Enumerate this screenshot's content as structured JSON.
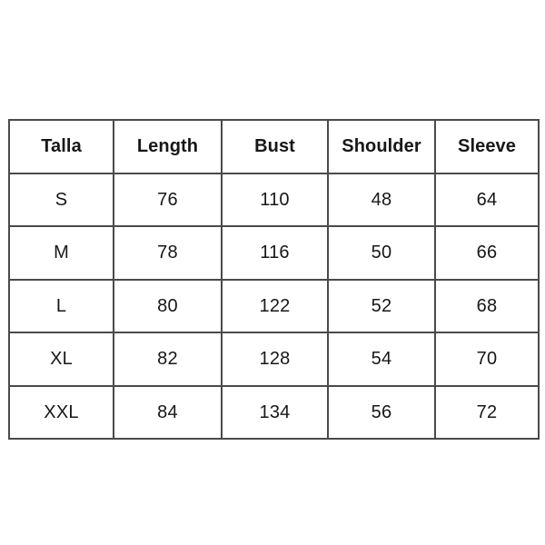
{
  "page": {
    "background_color": "#ffffff",
    "text_color": "#17171a",
    "border_color": "#4a4a4a"
  },
  "table": {
    "name": "garment-size-chart",
    "headers": [
      "Talla",
      "Length",
      "Bust",
      "Shoulder",
      "Sleeve"
    ],
    "rows": [
      {
        "size": "S",
        "length": "76",
        "bust": "110",
        "shoulder": "48",
        "sleeve": "64"
      },
      {
        "size": "M",
        "length": "78",
        "bust": "116",
        "shoulder": "50",
        "sleeve": "66"
      },
      {
        "size": "L",
        "length": "80",
        "bust": "122",
        "shoulder": "52",
        "sleeve": "68"
      },
      {
        "size": "XL",
        "length": "82",
        "bust": "128",
        "shoulder": "54",
        "sleeve": "70"
      },
      {
        "size": "XXL",
        "length": "84",
        "bust": "134",
        "shoulder": "56",
        "sleeve": "72"
      }
    ]
  },
  "chart_data": {
    "type": "table",
    "title": "",
    "columns": [
      "Talla",
      "Length",
      "Bust",
      "Shoulder",
      "Sleeve"
    ],
    "rows": [
      [
        "S",
        76,
        110,
        48,
        64
      ],
      [
        "M",
        78,
        116,
        50,
        66
      ],
      [
        "L",
        80,
        122,
        52,
        68
      ],
      [
        "XL",
        82,
        128,
        54,
        70
      ],
      [
        "XXL",
        84,
        134,
        56,
        72
      ]
    ]
  }
}
